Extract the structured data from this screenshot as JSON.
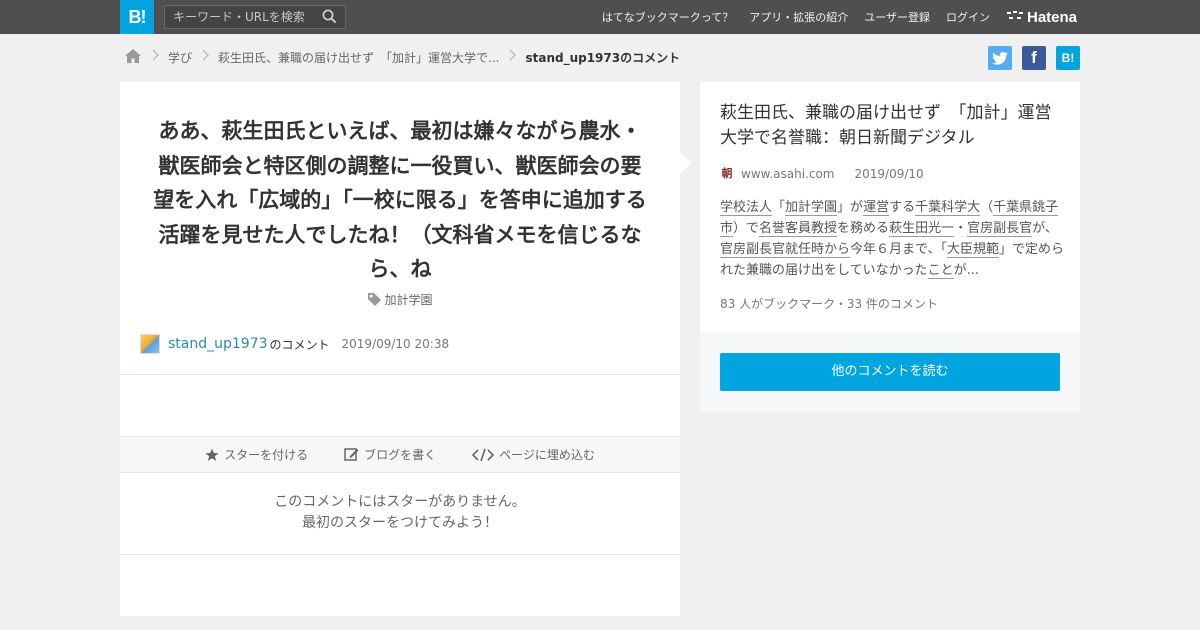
{
  "header": {
    "logo": "B!",
    "search_placeholder": "キーワード・URLを検索",
    "nav": [
      "はてなブックマークって？",
      "アプリ・拡張の紹介",
      "ユーザー登録",
      "ログイン"
    ],
    "brand": "Hatena"
  },
  "breadcrumb": {
    "items": [
      "学び",
      "萩生田氏、兼職の届け出せず　「加計」運営大学で..."
    ],
    "current": "stand_up1973のコメント"
  },
  "share": {
    "facebook": "f",
    "hatebu": "B!"
  },
  "comment": {
    "text": "ああ、萩生田氏といえば、最初は嫌々ながら農水・獣医師会と特区側の調整に一役買い、獣医師会の要望を入れ「広域的」「一校に限る」を答申に追加する活躍を見せた人でしたね！（文科省メモを信じるなら、ね",
    "tag": "加計学園",
    "user": "stand_up1973",
    "user_suffix": "のコメント",
    "timestamp": "2019/09/10 20:38"
  },
  "actions": {
    "star": "スターを付ける",
    "blog": "ブログを書く",
    "embed": "ページに埋め込む"
  },
  "stars": {
    "empty_line1": "このコメントにはスターがありません。",
    "empty_line2": "最初のスターをつけてみよう！"
  },
  "entry": {
    "title": "萩生田氏、兼職の届け出せず　「加計」運営大学で名誉職：朝日新聞デジタル",
    "favicon": "朝",
    "domain": "www.asahi.com",
    "date": "2019/09/10",
    "summary_parts": [
      [
        "学校法人",
        true
      ],
      [
        "「",
        false
      ],
      [
        "加計学園",
        true
      ],
      [
        "」が",
        false
      ],
      [
        "運営",
        true
      ],
      [
        "する",
        false
      ],
      [
        "千葉科学大",
        true
      ],
      [
        "（",
        false
      ],
      [
        "千葉県銚子市",
        true
      ],
      [
        "）で",
        false
      ],
      [
        "名誉客員教授",
        true
      ],
      [
        "を務める",
        false
      ],
      [
        "萩生田光一",
        true
      ],
      [
        "・",
        false
      ],
      [
        "官房副長官",
        true
      ],
      [
        "が、",
        false
      ],
      [
        "官房副長官",
        true
      ],
      [
        "就任時から",
        true
      ],
      [
        "今年６月まで、「",
        false
      ],
      [
        "大臣規範",
        true
      ],
      [
        "」で定められた兼職の届け出をしていなかった",
        false
      ],
      [
        "こと",
        true
      ],
      [
        "が...",
        false
      ]
    ],
    "counts": "83 人がブックマーク・33 件のコメント",
    "read_button": "他のコメントを読む"
  },
  "colors": {
    "brand_blue": "#00a4de",
    "topbar": "#4f4f4f",
    "link": "#2a8bb5"
  }
}
